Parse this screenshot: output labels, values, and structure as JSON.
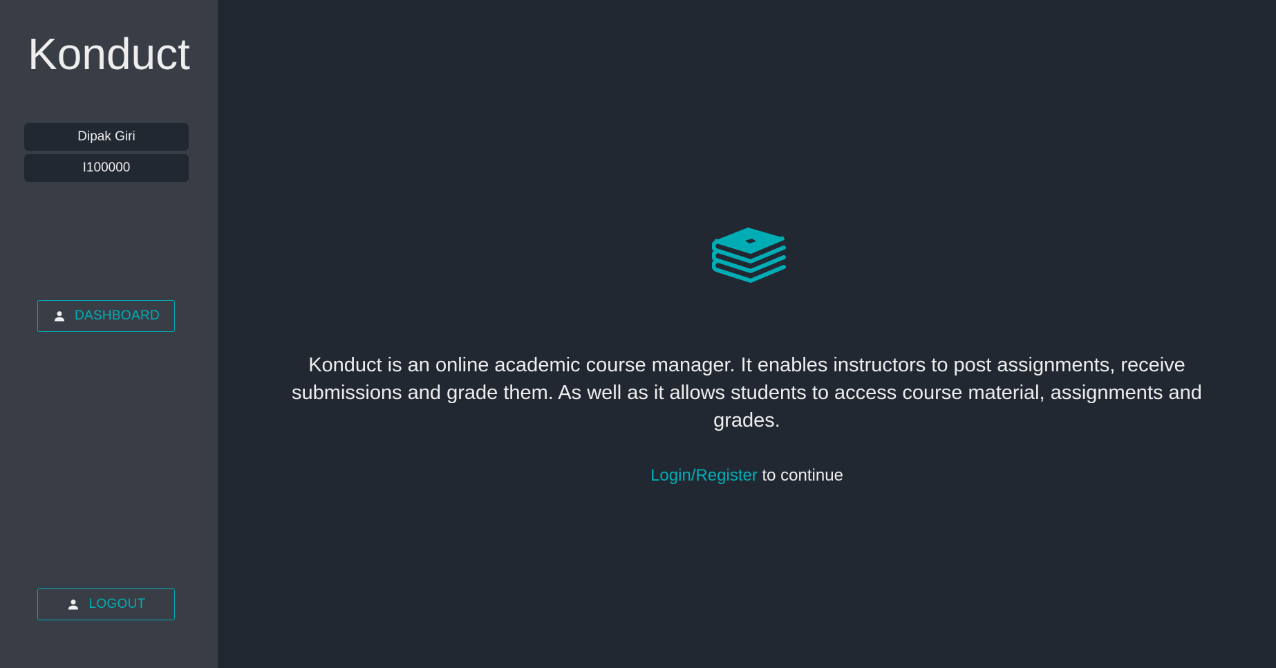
{
  "app": {
    "brand": "Konduct",
    "accent_color": "#00adb5",
    "background_color": "#222831",
    "sidebar_color": "#393e46"
  },
  "sidebar": {
    "user_name": "Dipak Giri",
    "user_id": "I100000",
    "dashboard_button": {
      "label": "DASHBOARD",
      "icon": "person-icon"
    },
    "logout_button": {
      "label": "LOGOUT",
      "icon": "person-icon"
    }
  },
  "main": {
    "logo_icon": "books-stack-icon",
    "description": "Konduct is an online academic course manager. It enables instructors to post assignments, receive submissions and grade them. As well as it allows students to access course material, assignments and grades.",
    "cta": {
      "link_label": "Login/Register",
      "suffix": " to continue"
    }
  }
}
